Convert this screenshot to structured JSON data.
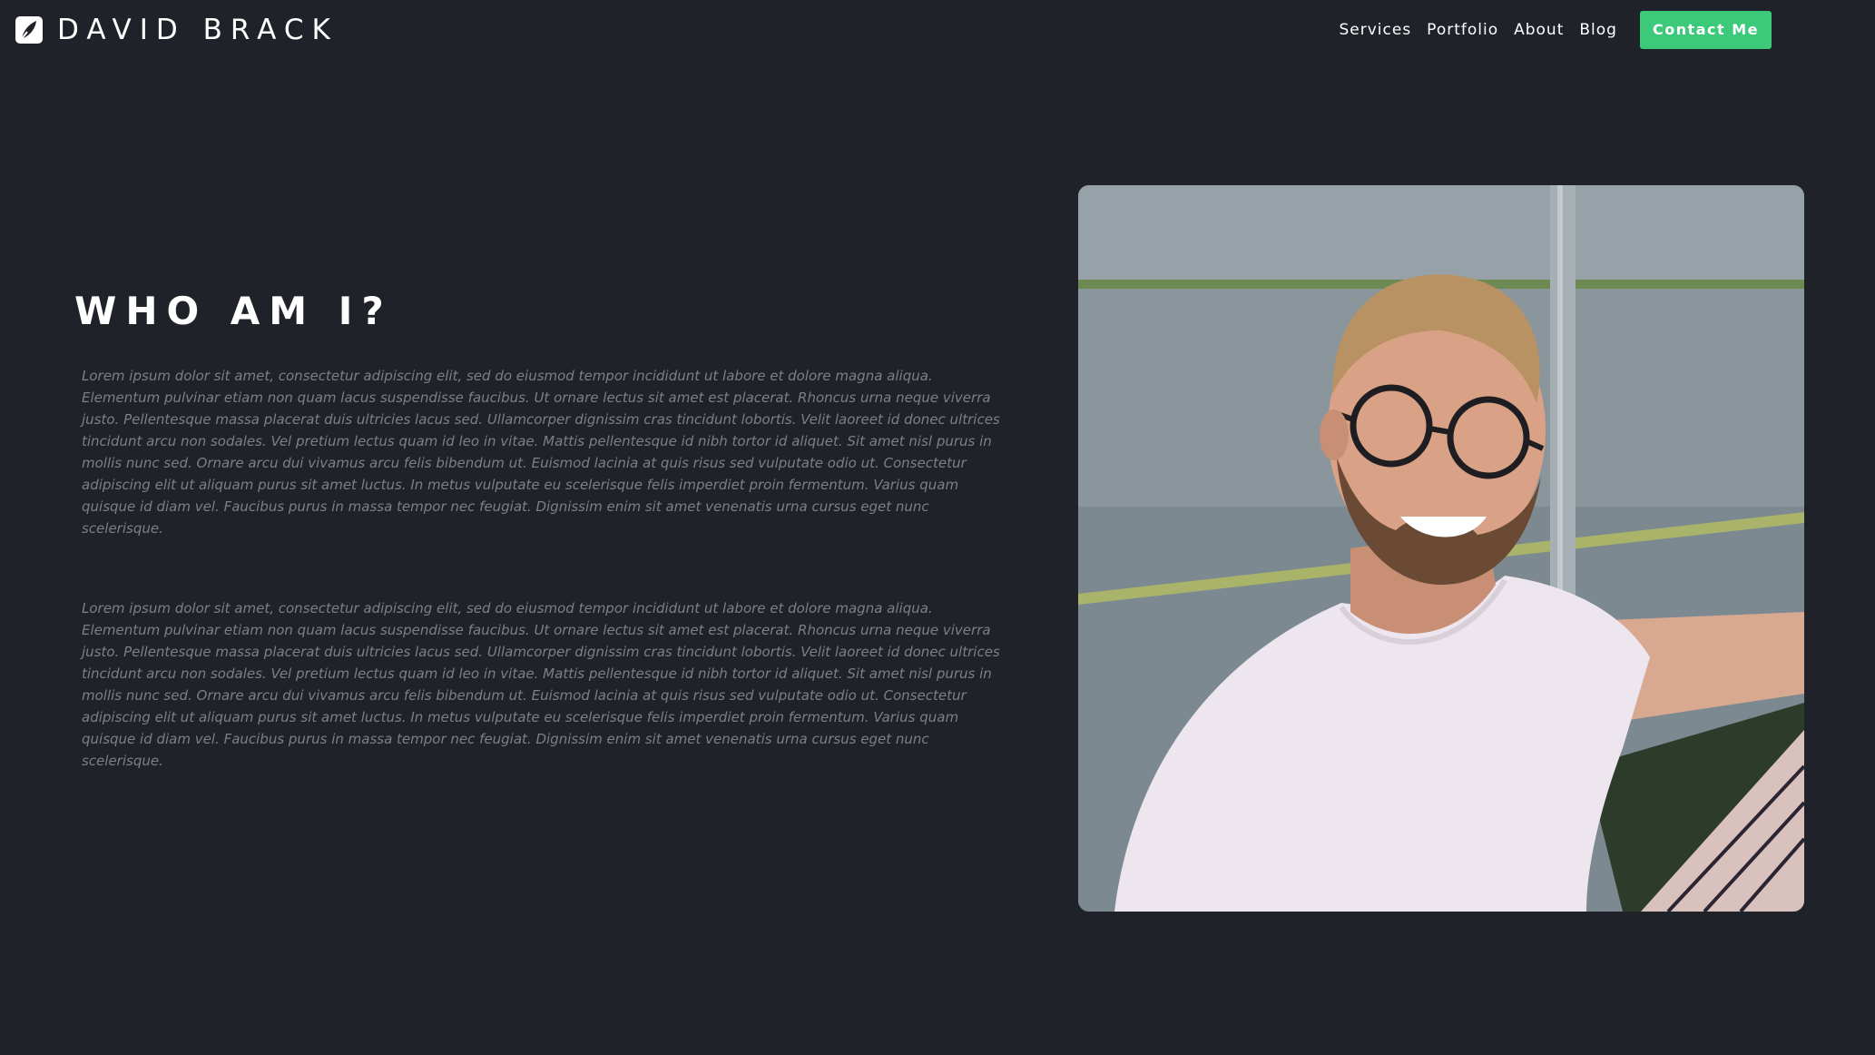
{
  "brand": {
    "name": "DAVID BRACK",
    "icon": "feather-icon"
  },
  "nav": {
    "links": [
      "Services",
      "Portfolio",
      "About",
      "Blog"
    ],
    "cta": "Contact Me"
  },
  "colors": {
    "background": "#1f2228",
    "accent": "#3cc97a",
    "text": "#ffffff",
    "muted_text": "#7b8087"
  },
  "about": {
    "heading": "WHO AM I?",
    "paragraphs": [
      "Lorem ipsum dolor sit amet, consectetur adipiscing elit, sed do eiusmod tempor incididunt ut labore et dolore magna aliqua. Elementum pulvinar etiam non quam lacus suspendisse faucibus. Ut ornare lectus sit amet est placerat. Rhoncus urna neque viverra justo. Pellentesque massa placerat duis ultricies lacus sed. Ullamcorper dignissim cras tincidunt lobortis. Velit laoreet id donec ultrices tincidunt arcu non sodales. Vel pretium lectus quam id leo in vitae. Mattis pellentesque id nibh tortor id aliquet. Sit amet nisl purus in mollis nunc sed. Ornare arcu dui vivamus arcu felis bibendum ut. Euismod lacinia at quis risus sed vulputate odio ut. Consectetur adipiscing elit ut aliquam purus sit amet luctus. In metus vulputate eu scelerisque felis imperdiet proin fermentum. Varius quam quisque id diam vel. Faucibus purus in massa tempor nec feugiat. Dignissim enim sit amet venenatis urna cursus eget nunc scelerisque.",
      "Lorem ipsum dolor sit amet, consectetur adipiscing elit, sed do eiusmod tempor incididunt ut labore et dolore magna aliqua. Elementum pulvinar etiam non quam lacus suspendisse faucibus. Ut ornare lectus sit amet est placerat. Rhoncus urna neque viverra justo. Pellentesque massa placerat duis ultricies lacus sed. Ullamcorper dignissim cras tincidunt lobortis. Velit laoreet id donec ultrices tincidunt arcu non sodales. Vel pretium lectus quam id leo in vitae. Mattis pellentesque id nibh tortor id aliquet. Sit amet nisl purus in mollis nunc sed. Ornare arcu dui vivamus arcu felis bibendum ut. Euismod lacinia at quis risus sed vulputate odio ut. Consectetur adipiscing elit ut aliquam purus sit amet luctus. In metus vulputate eu scelerisque felis imperdiet proin fermentum. Varius quam quisque id diam vel. Faucibus purus in massa tempor nec feugiat. Dignissim enim sit amet venenatis urna cursus eget nunc scelerisque."
    ]
  }
}
